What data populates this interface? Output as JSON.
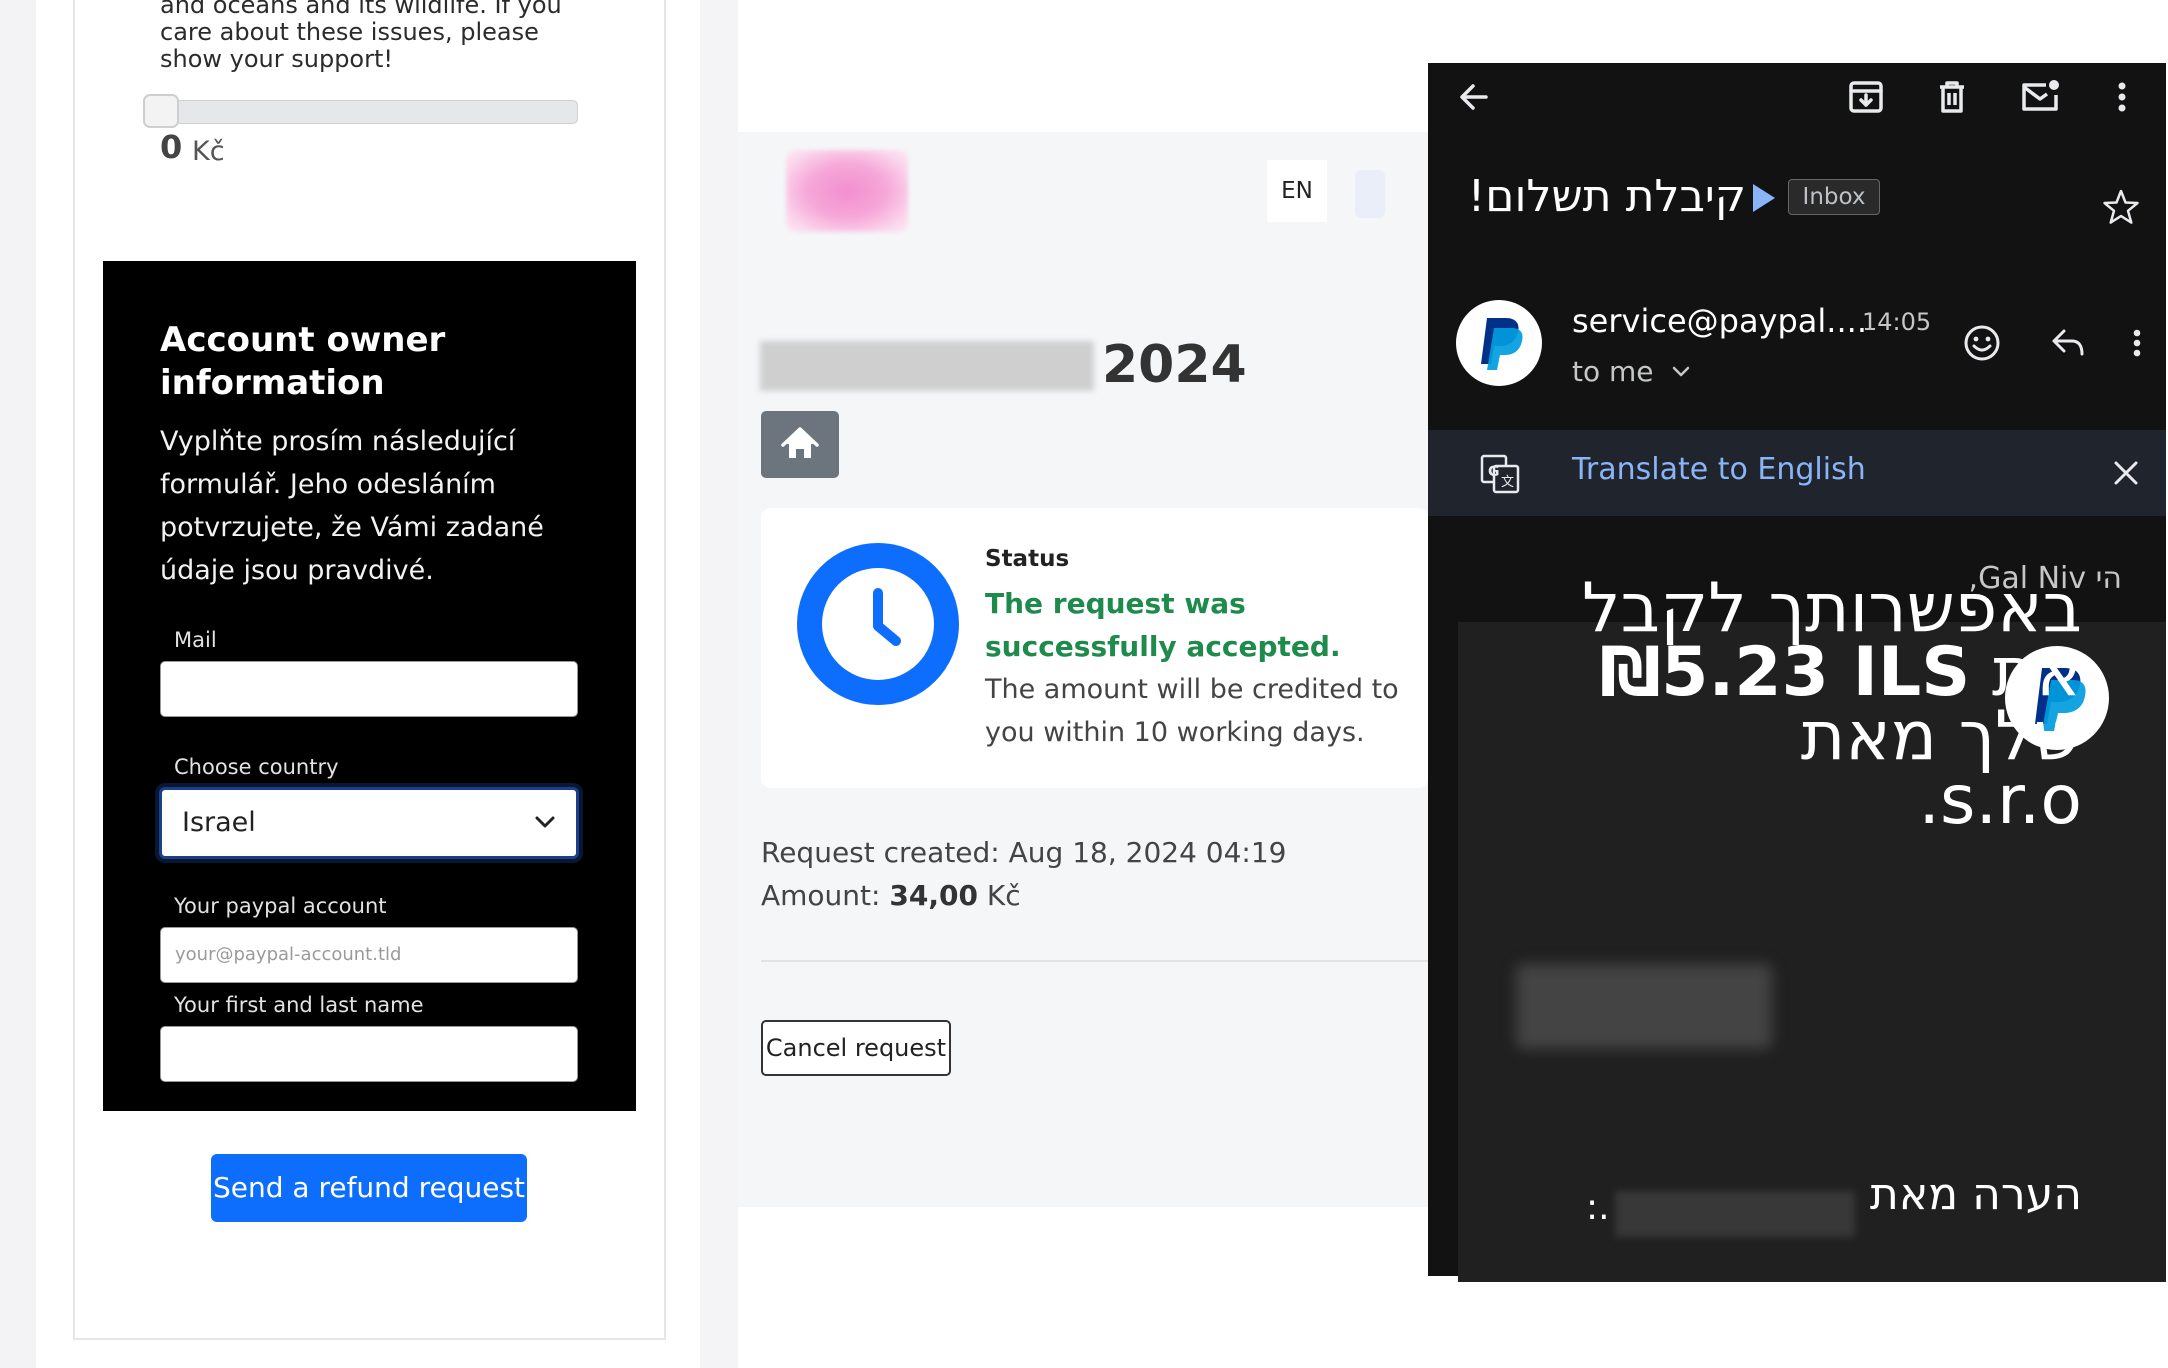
{
  "refund_form": {
    "intro_text": "and oceans and its wildlife. If you care about these issues, please show your support!",
    "donation_value": "0",
    "donation_fraction": 0,
    "donation_unit": "Kč",
    "owner_title": "Account owner information",
    "owner_description": "Vyplňte prosím následující formulář. Jeho odesláním potvrzujete, že Vámi zadané údaje jsou pravdivé.",
    "mail_label": "Mail",
    "mail_value": "",
    "country_label": "Choose country",
    "country_value": "Israel",
    "paypal_label": "Your paypal account",
    "paypal_placeholder": "your@paypal-account.tld",
    "name_label": "Your first and last name",
    "name_value": "",
    "submit_label": "Send a refund request"
  },
  "request_page": {
    "language": "EN",
    "title_year": "2024",
    "status_label": "Status",
    "status_value": "The request was successfully accepted.",
    "status_info": "The amount will be credited to you within 10 working days.",
    "created_label": "Request created:",
    "created_value": "Aug 18, 2024 04:19",
    "amount_label": "Amount:",
    "amount_value": "34,00",
    "amount_unit": "Kč",
    "cancel_label": "Cancel request"
  },
  "gmail": {
    "subject": "קיבלת תשלום!",
    "label": "Inbox",
    "sender": "service@paypal....",
    "time": "14:05",
    "recipient": "to me",
    "translate_label": "Translate to English",
    "greeting": "הי Gal Niv,",
    "body_line_1": "באפשרותך לקבל",
    "body_line_2_prefix": "את",
    "body_amount": "₪5.23 ILS",
    "body_line_3": "שלך מאת",
    "body_line_4": "s.r.o.",
    "note_label": "הערה מאת",
    "note_suffix": ":.",
    "colors": {
      "background": "#121212",
      "link": "#8ab4f8",
      "paypal_dark": "#003087",
      "paypal_light": "#009cde"
    },
    "icons": [
      "back-arrow-icon",
      "archive-icon",
      "trash-icon",
      "mark-unread-icon",
      "more-vert-icon",
      "star-icon",
      "emoji-icon",
      "reply-icon",
      "translate-icon",
      "close-icon",
      "paypal-logo"
    ]
  },
  "colors": {
    "primary_button": "#0d6efd",
    "success_text": "#1e8a4c",
    "clock": "#0d6efd",
    "home_button": "#6c757d"
  }
}
